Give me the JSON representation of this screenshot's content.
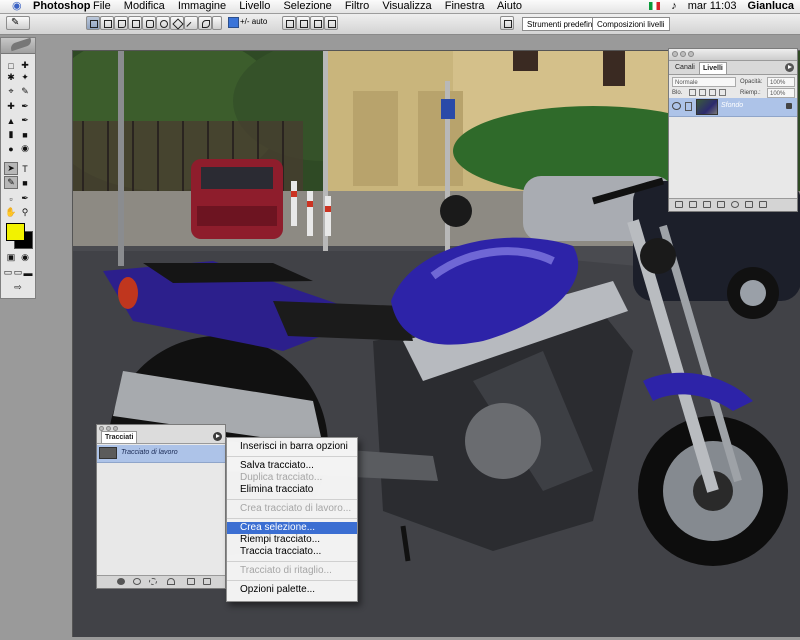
{
  "menubar": {
    "app_name": "Photoshop",
    "menus": [
      "File",
      "Modifica",
      "Immagine",
      "Livello",
      "Selezione",
      "Filtro",
      "Visualizza",
      "Finestra",
      "Aiuto"
    ],
    "clock": "mar 11:03",
    "user": "Gianluca"
  },
  "options_bar": {
    "auto_label": "+/- auto",
    "well_tabs": [
      "Strumenti predefiniti",
      "Composizioni livelli"
    ]
  },
  "layers_palette": {
    "tabs": [
      "Canali",
      "Livelli"
    ],
    "active_tab": "Livelli",
    "blend_mode": "Normale",
    "opacity_label": "Opacità:",
    "opacity_value": "100%",
    "lock_label": "Blo.",
    "fill_label": "Riemp.:",
    "fill_value": "100%",
    "layers": [
      {
        "name": "Sfondo",
        "selected": true,
        "locked": true
      }
    ]
  },
  "paths_palette": {
    "tab": "Tracciati",
    "paths": [
      {
        "name": "Tracciato di lavoro",
        "selected": true
      }
    ]
  },
  "context_menu": {
    "items": [
      {
        "label": "Inserisci in barra opzioni",
        "enabled": true
      },
      {
        "label": "Salva tracciato...",
        "enabled": true
      },
      {
        "label": "Duplica tracciato...",
        "enabled": false
      },
      {
        "label": "Elimina tracciato",
        "enabled": true
      },
      {
        "label": "Crea tracciato di lavoro...",
        "enabled": false
      },
      {
        "label": "Crea selezione...",
        "enabled": true,
        "highlighted": true
      },
      {
        "label": "Riempi tracciato...",
        "enabled": true
      },
      {
        "label": "Traccia tracciato...",
        "enabled": true
      },
      {
        "label": "Tracciato di ritaglio...",
        "enabled": false
      },
      {
        "label": "Opzioni palette...",
        "enabled": true
      }
    ]
  },
  "colors": {
    "foreground": "#f2f200",
    "background": "#000000",
    "highlight": "#3b6ed2",
    "selection_row": "#adc3e8"
  },
  "icons": {
    "apple": "apple-icon",
    "toolbox": [
      "marquee-icon",
      "move-icon",
      "lasso-icon",
      "magic-wand-icon",
      "crop-icon",
      "slice-icon",
      "healing-brush-icon",
      "brush-icon",
      "clone-stamp-icon",
      "history-brush-icon",
      "eraser-icon",
      "gradient-icon",
      "blur-icon",
      "dodge-icon",
      "path-selection-icon",
      "type-icon",
      "pen-icon",
      "shape-icon",
      "notes-icon",
      "eyedropper-icon",
      "hand-icon",
      "zoom-icon"
    ]
  }
}
